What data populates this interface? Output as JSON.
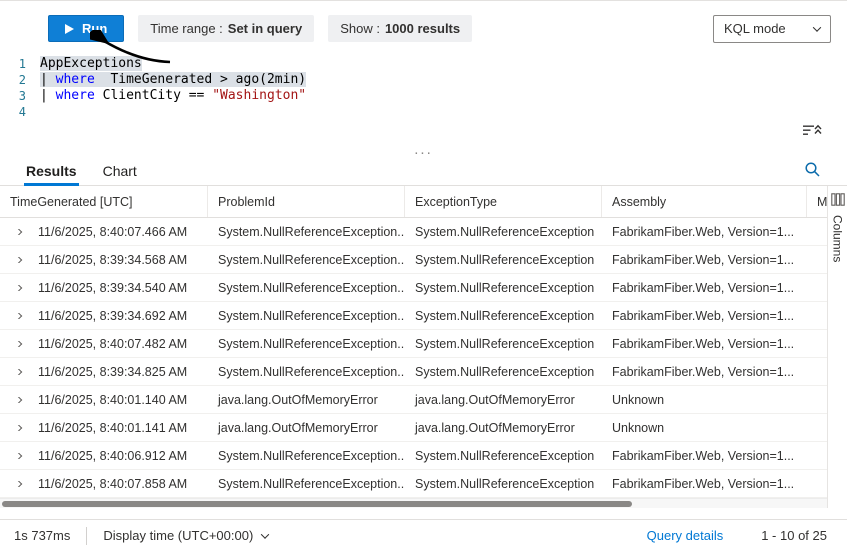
{
  "toolbar": {
    "run": {
      "label": "Run"
    },
    "time_range": {
      "label": "Time range :",
      "value": "Set in query"
    },
    "show": {
      "label": "Show :",
      "value": "1000 results"
    },
    "kql_mode": {
      "label": "KQL mode"
    }
  },
  "editor": {
    "lines": [
      {
        "num": "1",
        "segments": [
          {
            "text": "AppExceptions",
            "cls": "plain",
            "bg": true
          }
        ]
      },
      {
        "num": "2",
        "segments": [
          {
            "text": "| ",
            "cls": "plain",
            "bg": true
          },
          {
            "text": "where",
            "cls": "kw",
            "bg": true
          },
          {
            "text": "  TimeGenerated > ago(",
            "cls": "plain",
            "bg": true
          },
          {
            "text": "2min",
            "cls": "plain",
            "bg": true
          },
          {
            "text": ")",
            "cls": "plain",
            "bg": true
          }
        ]
      },
      {
        "num": "3",
        "segments": [
          {
            "text": "| ",
            "cls": "plain"
          },
          {
            "text": "where",
            "cls": "kw"
          },
          {
            "text": " ClientCity == ",
            "cls": "plain"
          },
          {
            "text": "\"Washington\"",
            "cls": "str"
          }
        ]
      },
      {
        "num": "4",
        "segments": []
      }
    ]
  },
  "splitter_dots": "...",
  "results_panel": {
    "tabs": [
      {
        "label": "Results",
        "active": true
      },
      {
        "label": "Chart",
        "active": false
      }
    ],
    "columns_panel_label": "Columns"
  },
  "table": {
    "columns": [
      "TimeGenerated [UTC]",
      "ProblemId",
      "ExceptionType",
      "Assembly",
      "M"
    ],
    "rows": [
      {
        "time": "11/6/2025, 8:40:07.466 AM",
        "problem_id": "System.NullReferenceException...",
        "exception_type": "System.NullReferenceException",
        "assembly": "FabrikamFiber.Web, Version=1..."
      },
      {
        "time": "11/6/2025, 8:39:34.568 AM",
        "problem_id": "System.NullReferenceException...",
        "exception_type": "System.NullReferenceException",
        "assembly": "FabrikamFiber.Web, Version=1..."
      },
      {
        "time": "11/6/2025, 8:39:34.540 AM",
        "problem_id": "System.NullReferenceException...",
        "exception_type": "System.NullReferenceException",
        "assembly": "FabrikamFiber.Web, Version=1..."
      },
      {
        "time": "11/6/2025, 8:39:34.692 AM",
        "problem_id": "System.NullReferenceException...",
        "exception_type": "System.NullReferenceException",
        "assembly": "FabrikamFiber.Web, Version=1..."
      },
      {
        "time": "11/6/2025, 8:40:07.482 AM",
        "problem_id": "System.NullReferenceException...",
        "exception_type": "System.NullReferenceException",
        "assembly": "FabrikamFiber.Web, Version=1..."
      },
      {
        "time": "11/6/2025, 8:39:34.825 AM",
        "problem_id": "System.NullReferenceException...",
        "exception_type": "System.NullReferenceException",
        "assembly": "FabrikamFiber.Web, Version=1..."
      },
      {
        "time": "11/6/2025, 8:40:01.140 AM",
        "problem_id": "java.lang.OutOfMemoryError",
        "exception_type": "java.lang.OutOfMemoryError",
        "assembly": "Unknown"
      },
      {
        "time": "11/6/2025, 8:40:01.141 AM",
        "problem_id": "java.lang.OutOfMemoryError",
        "exception_type": "java.lang.OutOfMemoryError",
        "assembly": "Unknown"
      },
      {
        "time": "11/6/2025, 8:40:06.912 AM",
        "problem_id": "System.NullReferenceException...",
        "exception_type": "System.NullReferenceException",
        "assembly": "FabrikamFiber.Web, Version=1..."
      },
      {
        "time": "11/6/2025, 8:40:07.858 AM",
        "problem_id": "System.NullReferenceException...",
        "exception_type": "System.NullReferenceException",
        "assembly": "FabrikamFiber.Web, Version=1..."
      }
    ]
  },
  "footer": {
    "duration": "1s 737ms",
    "display_time_label": "Display time (UTC+00:00)",
    "query_details_label": "Query details",
    "pagination": "1 - 10 of 25"
  },
  "colors": {
    "accent": "#0078d4",
    "run_button_bg": "#0f7fd6",
    "keyword": "#0000ff",
    "string_literal": "#a31515",
    "annotation_arrow": "#000000"
  }
}
